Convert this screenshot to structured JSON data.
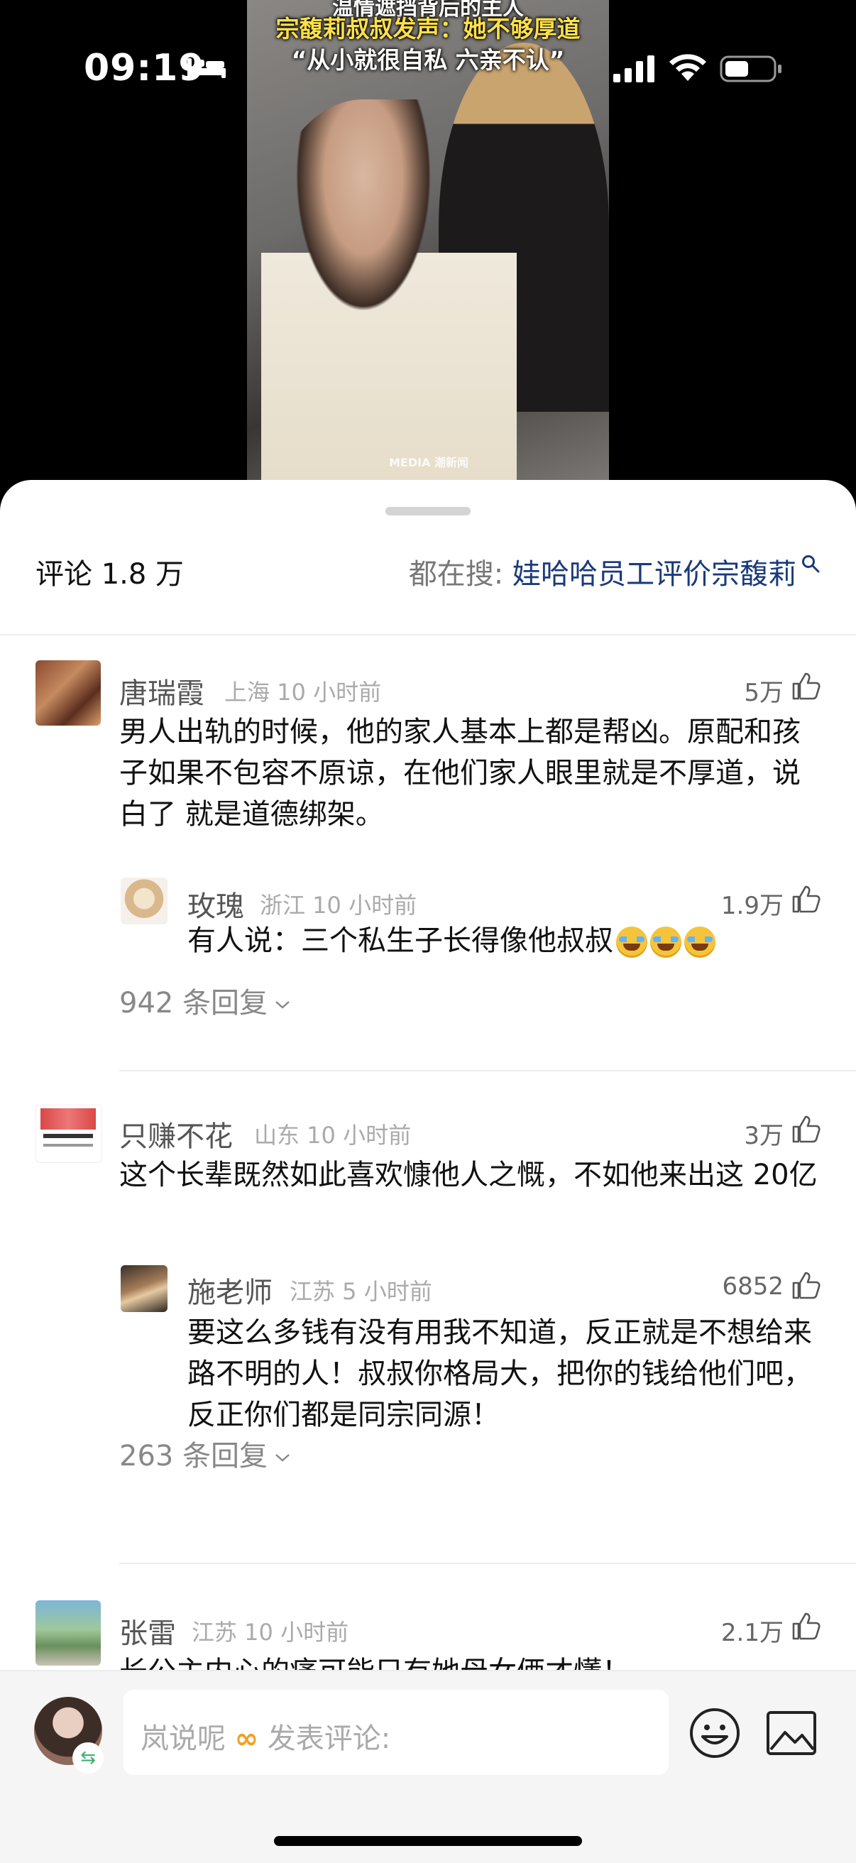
{
  "status_bar": {
    "time": "09:19"
  },
  "video": {
    "caption_line0": "温情遮挡背后的主人",
    "caption_line1": "宗馥莉叔叔发声：她不够厚道",
    "caption_line2": "“从小就很自私 六亲不认”",
    "watermark": "MEDIA 潮新闻"
  },
  "comments_header": {
    "title": "评论 1.8 万",
    "search_prefix": "都在搜: ",
    "search_keyword": "娃哈哈员工评价宗馥莉"
  },
  "comments": [
    {
      "name": "唐瑞霞",
      "meta": "上海 10 小时前",
      "likes": "5万",
      "text": "男人出轨的时候，他的家人基本上都是帮凶。原配和孩子如果不包容不原谅，在他们家人眼里就是不厚道，说白了 就是道德绑架。",
      "reply": {
        "name": "玫瑰",
        "meta": "浙江 10 小时前",
        "likes": "1.9万",
        "text": "有人说：三个私生子长得像他叔叔"
      },
      "more_replies": "942 条回复"
    },
    {
      "name": "只赚不花",
      "meta": "山东 10 小时前",
      "likes": "3万",
      "text": "这个长辈既然如此喜欢慷他人之慨，不如他来出这 20亿",
      "reply": {
        "name": "施老师",
        "meta": "江苏 5 小时前",
        "likes": "6852",
        "text": "要这么多钱有没有用我不知道，反正就是不想给来路不明的人！叔叔你格局大，把你的钱给他们吧，反正你们都是同宗同源！"
      },
      "more_replies": "263 条回复"
    },
    {
      "name": "张雷",
      "meta": "江苏 10 小时前",
      "likes": "2.1万",
      "text": "长公主内心的痛可能只有她母女俩才懂！"
    }
  ],
  "composer": {
    "placeholder_prefix": "岚说呢",
    "placeholder_symbol": "∞",
    "placeholder_suffix": " 发表评论:"
  },
  "icons": [
    "bed-icon",
    "signal-icon",
    "wifi-icon",
    "battery-icon",
    "search-icon",
    "thumbs-up-icon",
    "chevron-down-icon",
    "emoji-icon",
    "image-icon",
    "switch-account-icon"
  ]
}
